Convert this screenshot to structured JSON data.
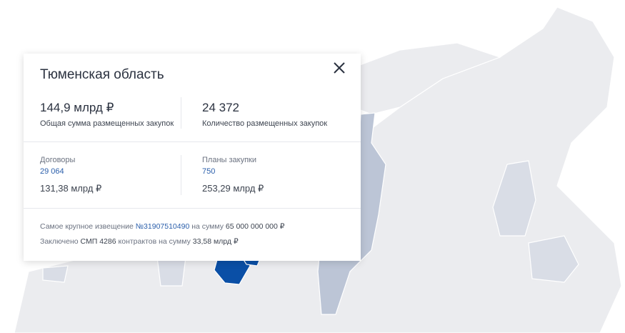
{
  "region": {
    "title": "Тюменская область",
    "highlight_color": "#0a4fa6"
  },
  "summary": {
    "total_sum": "144,9 млрд ₽",
    "total_sum_label": "Общая сумма размещенных закупок",
    "count": "24 372",
    "count_label": "Количество размещенных закупок"
  },
  "contracts": {
    "label": "Договоры",
    "count": "29 064",
    "sum": "131,38 млрд ₽"
  },
  "plans": {
    "label": "Планы закупки",
    "count": "750",
    "sum": "253,29 млрд ₽"
  },
  "notes": {
    "largest_prefix": "Самое крупное извещение",
    "largest_link": "№31907510490",
    "largest_mid": "на сумму",
    "largest_sum": "65 000 000 000 ₽",
    "smp_prefix": "Заключено",
    "smp_mid": "СМП 4286",
    "smp_text": "контрактов на сумму",
    "smp_sum": "33,58 млрд ₽"
  },
  "icons": {
    "close": "close-icon"
  }
}
